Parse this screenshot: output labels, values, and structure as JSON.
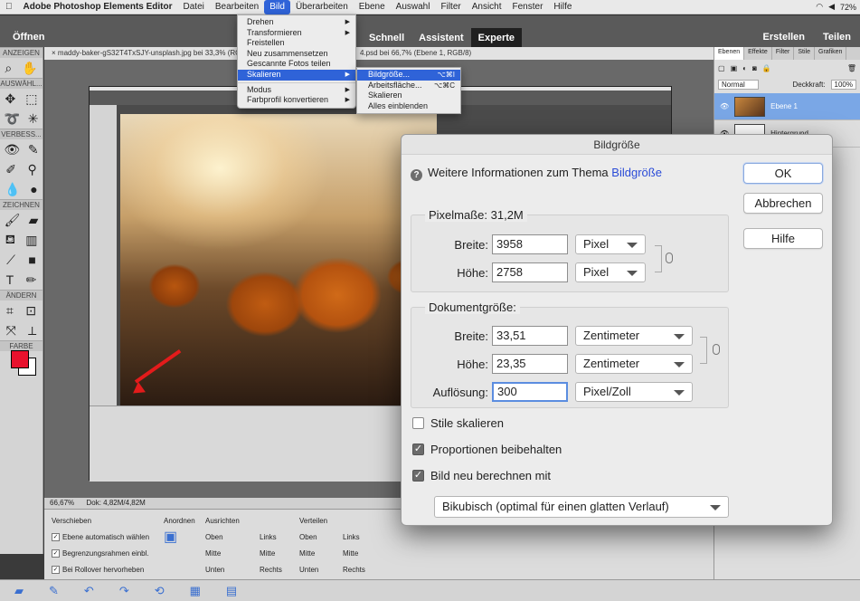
{
  "menubar": {
    "apple": "",
    "app_name": "Adobe Photoshop Elements Editor",
    "items": [
      "Datei",
      "Bearbeiten",
      "Bild",
      "Überarbeiten",
      "Ebene",
      "Auswahl",
      "Filter",
      "Ansicht",
      "Fenster",
      "Hilfe"
    ],
    "active": "Bild",
    "status_right": "72%"
  },
  "topbar": {
    "open_label": "Öffnen",
    "modes": [
      "Schnell",
      "Assistent",
      "Experte"
    ],
    "selected_mode": "Experte",
    "create_label": "Erstellen",
    "share_label": "Teilen"
  },
  "toolbox": {
    "sections": [
      "ANZEIGEN",
      "AUSWÄHL...",
      "VERBESS...",
      "ZEICHNEN",
      "ÄNDERN",
      "FARBE"
    ],
    "foreground_color": "#e8112d",
    "background_color": "#ffffff"
  },
  "document": {
    "tab_label": "maddy-baker-gS32T4TxSJY-unsplash.jpg bei 33,3% (RG",
    "tab2_label": "4.psd bei 66,7% (Ebene 1, RGB/8)",
    "status_zoom": "66,67%",
    "status_doc": "Dok: 4,82M/4,82M"
  },
  "bottom_panel": {
    "headers": [
      "Verschieben",
      "Anordnen",
      "Ausrichten",
      "Verteilen"
    ],
    "options": [
      {
        "label": "Ebene automatisch wählen",
        "checked": true
      },
      {
        "label": "Begrenzungsrahmen einbl.",
        "checked": true
      },
      {
        "label": "Bei Rollover hervorheben",
        "checked": true
      }
    ],
    "align": [
      "Oben",
      "Mitte",
      "Unten",
      "Links",
      "Mitte",
      "Rechts"
    ],
    "distribute": [
      "Oben",
      "Mitte",
      "Unten",
      "Links",
      "Mitte",
      "Rechts"
    ]
  },
  "layers_panel": {
    "tabs": [
      "Ebenen",
      "Effekte",
      "Filter",
      "Stile",
      "Grafiken"
    ],
    "blend_mode": "Normal",
    "opacity_label": "Deckkraft:",
    "opacity_value": "100%",
    "layers": [
      {
        "name": "Ebene 1",
        "selected": true
      },
      {
        "name": "Hintergrund",
        "selected": false
      }
    ]
  },
  "bild_menu": {
    "items": [
      {
        "label": "Drehen",
        "submenu": true
      },
      {
        "label": "Transformieren",
        "submenu": true
      },
      {
        "label": "Freistellen",
        "submenu": false
      },
      {
        "label": "Neu zusammensetzen",
        "submenu": false
      },
      {
        "label": "Gescannte Fotos teilen",
        "submenu": false
      },
      {
        "label": "Skalieren",
        "submenu": true,
        "highlighted": true
      },
      {
        "label": "Modus",
        "submenu": true
      },
      {
        "label": "Farbprofil konvertieren",
        "submenu": true
      }
    ],
    "skalieren_submenu": [
      {
        "label": "Bildgröße...",
        "shortcut": "⌥⌘I",
        "highlighted": true
      },
      {
        "label": "Arbeitsfläche...",
        "shortcut": "⌥⌘C"
      },
      {
        "label": "Skalieren",
        "shortcut": ""
      },
      {
        "label": "Alles einblenden",
        "shortcut": ""
      }
    ]
  },
  "dialog": {
    "title": "Bildgröße",
    "info_text": "Weitere Informationen zum Thema",
    "info_link": "Bildgröße",
    "ok_label": "OK",
    "cancel_label": "Abbrechen",
    "help_label": "Hilfe",
    "pixel_dims": {
      "label": "Pixelmaße: 31,2M",
      "width_label": "Breite:",
      "width_value": "3958",
      "width_unit": "Pixel",
      "height_label": "Höhe:",
      "height_value": "2758",
      "height_unit": "Pixel"
    },
    "doc_size": {
      "label": "Dokumentgröße:",
      "width_label": "Breite:",
      "width_value": "33,51",
      "width_unit": "Zentimeter",
      "height_label": "Höhe:",
      "height_value": "23,35",
      "height_unit": "Zentimeter",
      "resolution_label": "Auflösung:",
      "resolution_value": "300",
      "resolution_unit": "Pixel/Zoll"
    },
    "options": [
      {
        "label": "Stile skalieren",
        "checked": false
      },
      {
        "label": "Proportionen beibehalten",
        "checked": true
      },
      {
        "label": "Bild neu berechnen mit",
        "checked": true
      }
    ],
    "resample_method": "Bikubisch (optimal für einen glatten Verlauf)"
  }
}
